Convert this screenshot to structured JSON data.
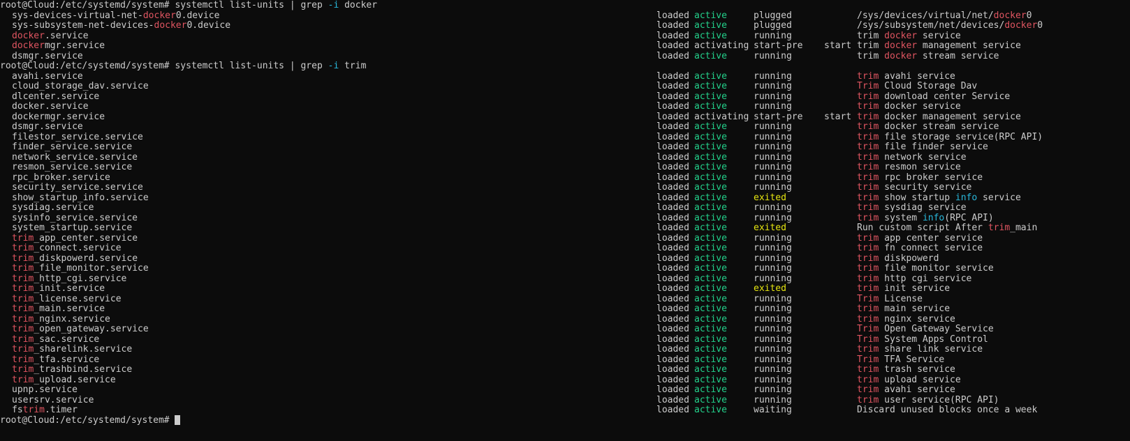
{
  "prompt": "root@Cloud:/etc/systemd/system#",
  "commands": [
    {
      "cmd": "systemctl list-units | grep ",
      "flag": "-i",
      "term": "docker"
    },
    {
      "cmd": "systemctl list-units | grep ",
      "flag": "-i",
      "term": "trim"
    }
  ],
  "colors": {
    "background": "#0c0c0c",
    "text": "#cccccc",
    "match": "#e05561",
    "active": "#23d18b",
    "info": "#29b8db",
    "exited": "#e5e510"
  },
  "docker_results": [
    {
      "unit": "sys-devices-virtual-net-docker0.device",
      "load": "loaded",
      "active": "active",
      "sub": "plugged",
      "job": "",
      "desc": "/sys/devices/virtual/net/docker0"
    },
    {
      "unit": "sys-subsystem-net-devices-docker0.device",
      "load": "loaded",
      "active": "active",
      "sub": "plugged",
      "job": "",
      "desc": "/sys/subsystem/net/devices/docker0"
    },
    {
      "unit": "docker.service",
      "load": "loaded",
      "active": "active",
      "sub": "running",
      "job": "",
      "desc": "trim docker service"
    },
    {
      "unit": "dockermgr.service",
      "load": "loaded",
      "active": "activating",
      "sub": "start-pre",
      "job": "start",
      "desc": "trim docker management service"
    },
    {
      "unit": "dsmgr.service",
      "load": "loaded",
      "active": "active",
      "sub": "running",
      "job": "",
      "desc": "trim docker stream service"
    }
  ],
  "trim_results": [
    {
      "unit": "avahi.service",
      "load": "loaded",
      "active": "active",
      "sub": "running",
      "job": "",
      "desc": "trim avahi service"
    },
    {
      "unit": "cloud_storage_dav.service",
      "load": "loaded",
      "active": "active",
      "sub": "running",
      "job": "",
      "desc": "Trim Cloud Storage Dav"
    },
    {
      "unit": "dlcenter.service",
      "load": "loaded",
      "active": "active",
      "sub": "running",
      "job": "",
      "desc": "trim download center Service"
    },
    {
      "unit": "docker.service",
      "load": "loaded",
      "active": "active",
      "sub": "running",
      "job": "",
      "desc": "trim docker service"
    },
    {
      "unit": "dockermgr.service",
      "load": "loaded",
      "active": "activating",
      "sub": "start-pre",
      "job": "start",
      "desc": "trim docker management service"
    },
    {
      "unit": "dsmgr.service",
      "load": "loaded",
      "active": "active",
      "sub": "running",
      "job": "",
      "desc": "trim docker stream service"
    },
    {
      "unit": "filestor_service.service",
      "load": "loaded",
      "active": "active",
      "sub": "running",
      "job": "",
      "desc": "trim file storage service(RPC API)"
    },
    {
      "unit": "finder_service.service",
      "load": "loaded",
      "active": "active",
      "sub": "running",
      "job": "",
      "desc": "trim file finder service"
    },
    {
      "unit": "network_service.service",
      "load": "loaded",
      "active": "active",
      "sub": "running",
      "job": "",
      "desc": "trim network service"
    },
    {
      "unit": "resmon_service.service",
      "load": "loaded",
      "active": "active",
      "sub": "running",
      "job": "",
      "desc": "trim resmon service"
    },
    {
      "unit": "rpc_broker.service",
      "load": "loaded",
      "active": "active",
      "sub": "running",
      "job": "",
      "desc": "trim rpc broker service"
    },
    {
      "unit": "security_service.service",
      "load": "loaded",
      "active": "active",
      "sub": "running",
      "job": "",
      "desc": "trim security service"
    },
    {
      "unit": "show_startup_info.service",
      "load": "loaded",
      "active": "active",
      "sub": "exited",
      "job": "",
      "desc": "trim show startup info service"
    },
    {
      "unit": "sysdiag.service",
      "load": "loaded",
      "active": "active",
      "sub": "running",
      "job": "",
      "desc": "trim sysdiag service"
    },
    {
      "unit": "sysinfo_service.service",
      "load": "loaded",
      "active": "active",
      "sub": "running",
      "job": "",
      "desc": "trim system info(RPC API)"
    },
    {
      "unit": "system_startup.service",
      "load": "loaded",
      "active": "active",
      "sub": "exited",
      "job": "",
      "desc": "Run custom script After trim_main"
    },
    {
      "unit": "trim_app_center.service",
      "load": "loaded",
      "active": "active",
      "sub": "running",
      "job": "",
      "desc": "trim app center service"
    },
    {
      "unit": "trim_connect.service",
      "load": "loaded",
      "active": "active",
      "sub": "running",
      "job": "",
      "desc": "trim fn connect service"
    },
    {
      "unit": "trim_diskpowerd.service",
      "load": "loaded",
      "active": "active",
      "sub": "running",
      "job": "",
      "desc": "trim diskpowerd"
    },
    {
      "unit": "trim_file_monitor.service",
      "load": "loaded",
      "active": "active",
      "sub": "running",
      "job": "",
      "desc": "trim file monitor service"
    },
    {
      "unit": "trim_http_cgi.service",
      "load": "loaded",
      "active": "active",
      "sub": "running",
      "job": "",
      "desc": "trim http cgi service"
    },
    {
      "unit": "trim_init.service",
      "load": "loaded",
      "active": "active",
      "sub": "exited",
      "job": "",
      "desc": "trim init service"
    },
    {
      "unit": "trim_license.service",
      "load": "loaded",
      "active": "active",
      "sub": "running",
      "job": "",
      "desc": "Trim License"
    },
    {
      "unit": "trim_main.service",
      "load": "loaded",
      "active": "active",
      "sub": "running",
      "job": "",
      "desc": "trim main service"
    },
    {
      "unit": "trim_nginx.service",
      "load": "loaded",
      "active": "active",
      "sub": "running",
      "job": "",
      "desc": "trim nginx service"
    },
    {
      "unit": "trim_open_gateway.service",
      "load": "loaded",
      "active": "active",
      "sub": "running",
      "job": "",
      "desc": "Trim Open Gateway Service"
    },
    {
      "unit": "trim_sac.service",
      "load": "loaded",
      "active": "active",
      "sub": "running",
      "job": "",
      "desc": "Trim System Apps Control"
    },
    {
      "unit": "trim_sharelink.service",
      "load": "loaded",
      "active": "active",
      "sub": "running",
      "job": "",
      "desc": "trim share link service"
    },
    {
      "unit": "trim_tfa.service",
      "load": "loaded",
      "active": "active",
      "sub": "running",
      "job": "",
      "desc": "Trim TFA Service"
    },
    {
      "unit": "trim_trashbind.service",
      "load": "loaded",
      "active": "active",
      "sub": "running",
      "job": "",
      "desc": "trim trash service"
    },
    {
      "unit": "trim_upload.service",
      "load": "loaded",
      "active": "active",
      "sub": "running",
      "job": "",
      "desc": "trim upload service"
    },
    {
      "unit": "upnp.service",
      "load": "loaded",
      "active": "active",
      "sub": "running",
      "job": "",
      "desc": "trim avahi service"
    },
    {
      "unit": "usersrv.service",
      "load": "loaded",
      "active": "active",
      "sub": "running",
      "job": "",
      "desc": "trim user service(RPC API)"
    },
    {
      "unit": "fstrim.timer",
      "load": "loaded",
      "active": "active",
      "sub": "waiting",
      "job": "",
      "desc": "Discard unused blocks once a week"
    }
  ]
}
